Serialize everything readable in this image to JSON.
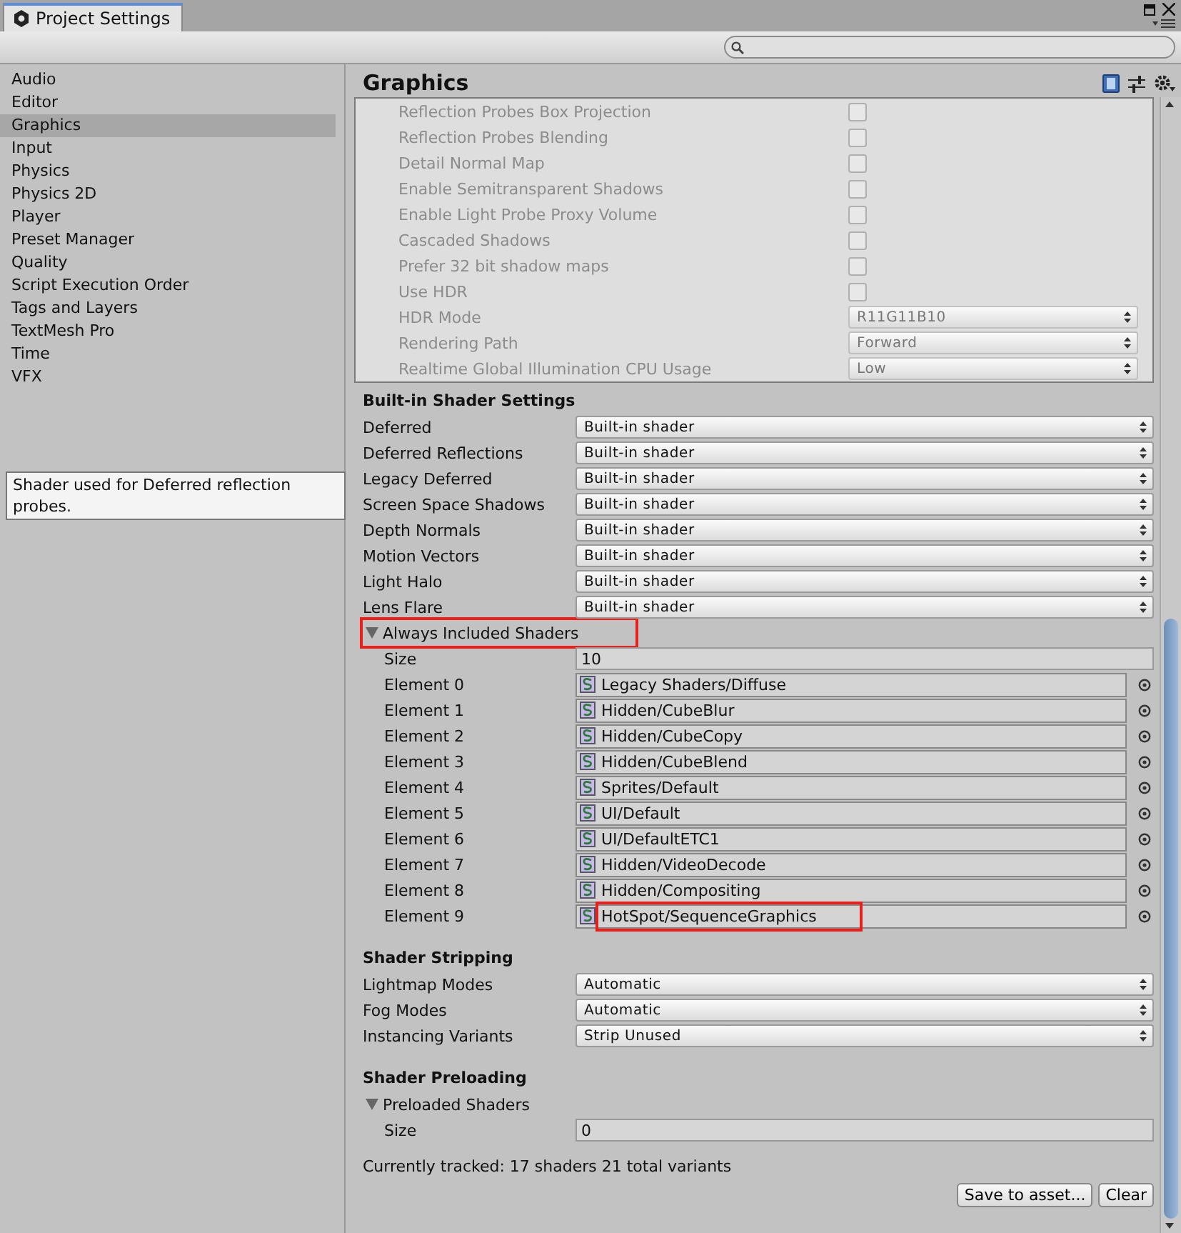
{
  "window": {
    "tab": "Project Settings"
  },
  "sidebar": {
    "items": [
      {
        "label": "Audio",
        "selected": false
      },
      {
        "label": "Editor",
        "selected": false
      },
      {
        "label": "Graphics",
        "selected": true
      },
      {
        "label": "Input",
        "selected": false
      },
      {
        "label": "Physics",
        "selected": false
      },
      {
        "label": "Physics 2D",
        "selected": false
      },
      {
        "label": "Player",
        "selected": false
      },
      {
        "label": "Preset Manager",
        "selected": false
      },
      {
        "label": "Quality",
        "selected": false
      },
      {
        "label": "Script Execution Order",
        "selected": false
      },
      {
        "label": "Tags and Layers",
        "selected": false
      },
      {
        "label": "TextMesh Pro",
        "selected": false
      },
      {
        "label": "Time",
        "selected": false
      },
      {
        "label": "VFX",
        "selected": false
      }
    ]
  },
  "panel": {
    "title": "Graphics",
    "tier_settings": {
      "disabled": true,
      "rows": [
        {
          "label": "Reflection Probes Box Projection",
          "kind": "checkbox",
          "checked": false
        },
        {
          "label": "Reflection Probes Blending",
          "kind": "checkbox",
          "checked": false
        },
        {
          "label": "Detail Normal Map",
          "kind": "checkbox",
          "checked": false
        },
        {
          "label": "Enable Semitransparent Shadows",
          "kind": "checkbox",
          "checked": false
        },
        {
          "label": "Enable Light Probe Proxy Volume",
          "kind": "checkbox",
          "checked": false
        },
        {
          "label": "Cascaded Shadows",
          "kind": "checkbox",
          "checked": false
        },
        {
          "label": "Prefer 32 bit shadow maps",
          "kind": "checkbox",
          "checked": false
        },
        {
          "label": "Use HDR",
          "kind": "checkbox",
          "checked": false
        },
        {
          "label": "HDR Mode",
          "kind": "dropdown",
          "value": "R11G11B10"
        },
        {
          "label": "Rendering Path",
          "kind": "dropdown",
          "value": "Forward"
        },
        {
          "label": "Realtime Global Illumination CPU Usage",
          "kind": "dropdown",
          "value": "Low"
        }
      ]
    },
    "builtin_shader_settings": {
      "title": "Built-in Shader Settings",
      "rows": [
        {
          "label": "Deferred",
          "value": "Built-in shader"
        },
        {
          "label": "Deferred Reflections",
          "value": "Built-in shader"
        },
        {
          "label": "Legacy Deferred",
          "value": "Built-in shader"
        },
        {
          "label": "Screen Space Shadows",
          "value": "Built-in shader"
        },
        {
          "label": "Depth Normals",
          "value": "Built-in shader"
        },
        {
          "label": "Motion Vectors",
          "value": "Built-in shader"
        },
        {
          "label": "Light Halo",
          "value": "Built-in shader"
        },
        {
          "label": "Lens Flare",
          "value": "Built-in shader"
        }
      ]
    },
    "tooltip": "Shader used for Deferred reflection probes.",
    "always_included_shaders": {
      "label": "Always Included Shaders",
      "expanded": true,
      "highlighted": true,
      "size_label": "Size",
      "size": "10",
      "elements": [
        {
          "label": "Element 0",
          "value": "Legacy Shaders/Diffuse",
          "highlighted": false
        },
        {
          "label": "Element 1",
          "value": "Hidden/CubeBlur",
          "highlighted": false
        },
        {
          "label": "Element 2",
          "value": "Hidden/CubeCopy",
          "highlighted": false
        },
        {
          "label": "Element 3",
          "value": "Hidden/CubeBlend",
          "highlighted": false
        },
        {
          "label": "Element 4",
          "value": "Sprites/Default",
          "highlighted": false
        },
        {
          "label": "Element 5",
          "value": "UI/Default",
          "highlighted": false
        },
        {
          "label": "Element 6",
          "value": "UI/DefaultETC1",
          "highlighted": false
        },
        {
          "label": "Element 7",
          "value": "Hidden/VideoDecode",
          "highlighted": false
        },
        {
          "label": "Element 8",
          "value": "Hidden/Compositing",
          "highlighted": false
        },
        {
          "label": "Element 9",
          "value": "HotSpot/SequenceGraphics",
          "highlighted": true
        }
      ]
    },
    "shader_stripping": {
      "title": "Shader Stripping",
      "rows": [
        {
          "label": "Lightmap Modes",
          "value": "Automatic"
        },
        {
          "label": "Fog Modes",
          "value": "Automatic"
        },
        {
          "label": "Instancing Variants",
          "value": "Strip Unused"
        }
      ]
    },
    "shader_preloading": {
      "title": "Shader Preloading",
      "foldout": {
        "label": "Preloaded Shaders",
        "expanded": true
      },
      "size_label": "Size",
      "size": "0",
      "status": "Currently tracked: 17 shaders 21 total variants",
      "buttons": [
        "Save to asset...",
        "Clear"
      ]
    }
  }
}
